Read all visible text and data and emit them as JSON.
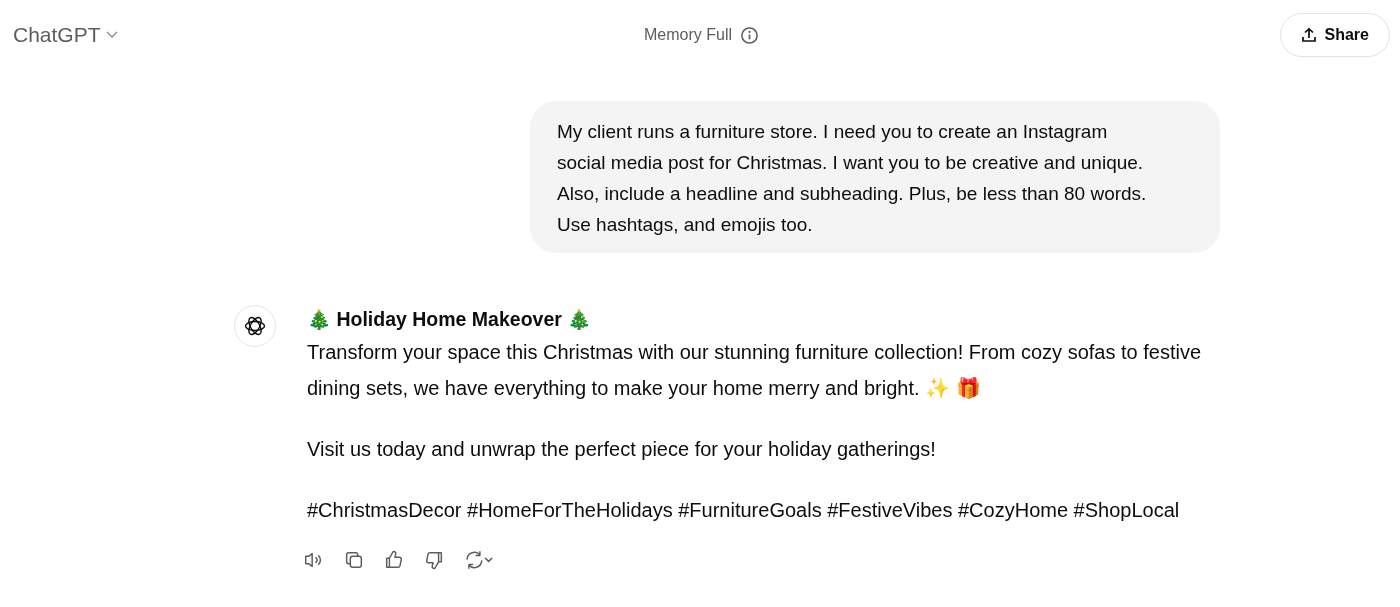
{
  "header": {
    "model_name": "ChatGPT",
    "memory_status": "Memory Full",
    "share_button": "Share"
  },
  "user_message": "My client runs a furniture store. I need you to create an Instagram social media post for Christmas. I want you to be creative and unique. Also, include a headline and subheading. Plus, be less than 80 words. Use hashtags, and emojis too.",
  "assistant_message": {
    "headline": "🎄 Holiday Home Makeover 🎄",
    "paragraphs": [
      "Transform your space this Christmas with our stunning furniture collection! From cozy sofas to festive dining sets, we have everything to make your home merry and bright. ✨ 🎁",
      "Visit us today and unwrap the perfect piece for your holiday gatherings!",
      "#ChristmasDecor #HomeForTheHolidays #FurnitureGoals #FestiveVibes #CozyHome #ShopLocal"
    ]
  }
}
